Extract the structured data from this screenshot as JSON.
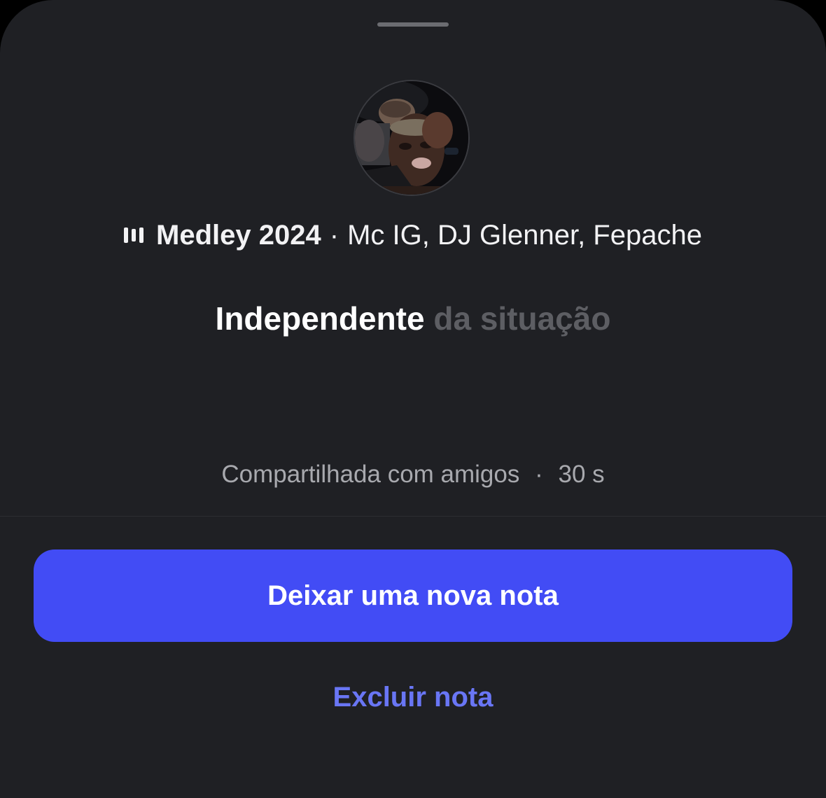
{
  "theme": {
    "background": "#1f2024",
    "accent": "#424cf5",
    "link": "#6976f5",
    "muted_text": "#a8a9ae",
    "lyric_dim": "#5d5e63"
  },
  "note": {
    "avatar_icon": "user-photo",
    "music": {
      "icon": "music-bars-icon",
      "title": "Medley 2024",
      "separator": "·",
      "artists": "Mc IG, DJ Glenner, Fepache"
    },
    "lyrics": {
      "active": "Independente",
      "rest": "da situação"
    },
    "shared": {
      "text": "Compartilhada com amigos",
      "separator": "·",
      "time": "30 s"
    }
  },
  "actions": {
    "primary_label": "Deixar uma nova nota",
    "secondary_label": "Excluir nota"
  }
}
